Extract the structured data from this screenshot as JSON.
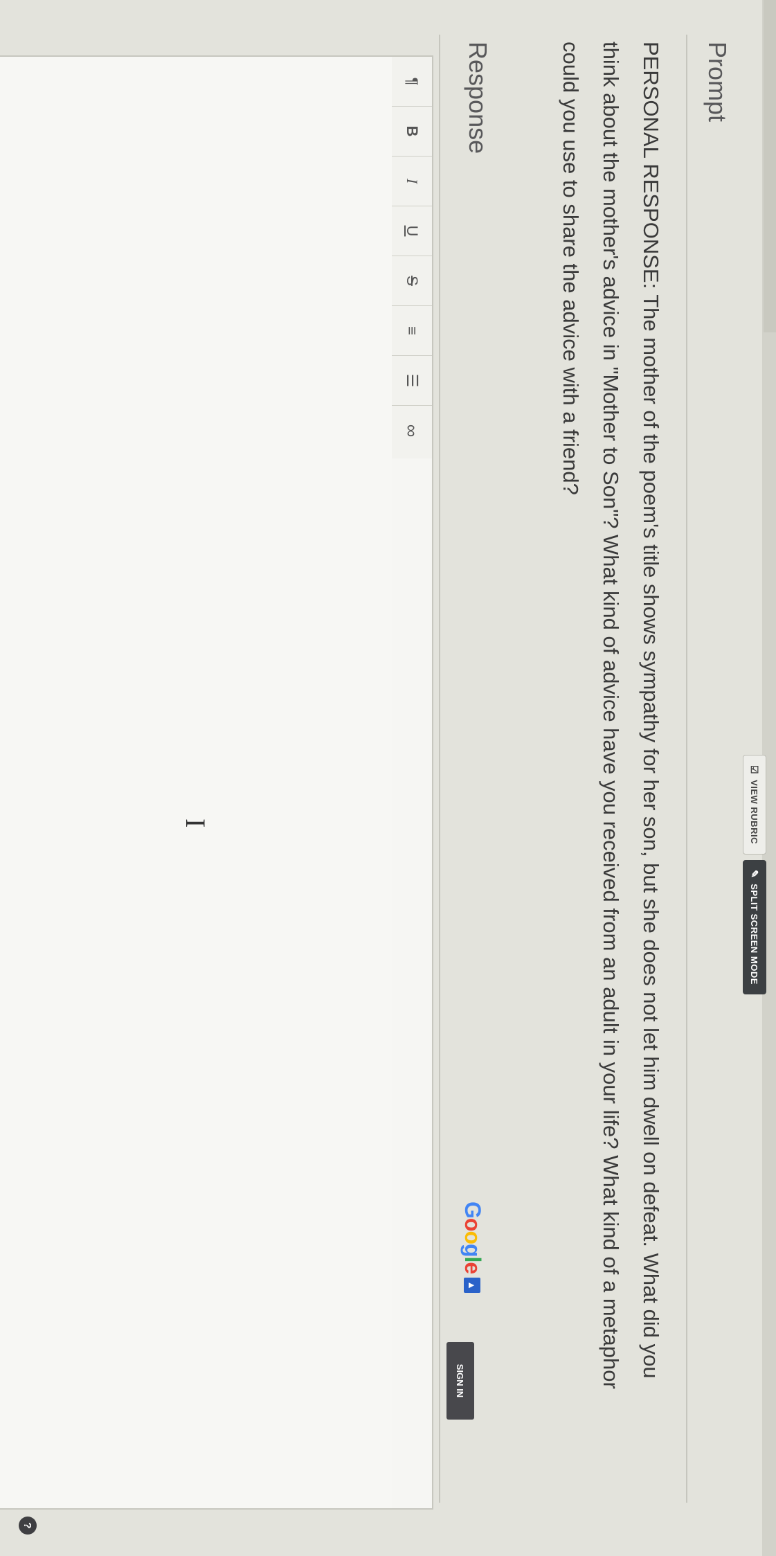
{
  "header": {
    "view_rubric_icon": "checkbox-icon",
    "view_rubric_label": "VIEW RUBRIC",
    "split_screen_icon": "pencil-icon",
    "split_screen_label": "SPLIT SCREEN MODE"
  },
  "prompt": {
    "title": "Prompt",
    "text": "PERSONAL RESPONSE: The mother of the poem's title shows sympathy for her son, but she does not let him dwell on defeat. What did you think about the mother's advice in \"Mother to Son\"? What kind of advice have you received from an adult in your life? What kind of a metaphor could you use to share the advice with a friend?"
  },
  "response": {
    "title": "Response",
    "google_letters": [
      "G",
      "o",
      "o",
      "g",
      "l",
      "e"
    ],
    "google_colors": [
      "#4285f4",
      "#ea4335",
      "#fbbc05",
      "#4285f4",
      "#34a853",
      "#ea4335"
    ],
    "drive_icon": "google-drive-icon",
    "sign_in_label": "SIGN IN"
  },
  "editor": {
    "toolbar": [
      {
        "name": "paragraph-button",
        "glyph": "¶"
      },
      {
        "name": "bold-button",
        "glyph": "B"
      },
      {
        "name": "italic-button",
        "glyph": "I"
      },
      {
        "name": "underline-button",
        "glyph": "U"
      },
      {
        "name": "strikethrough-button",
        "glyph": "S"
      },
      {
        "name": "align-button",
        "glyph": "≡"
      },
      {
        "name": "list-button",
        "glyph": "☰"
      },
      {
        "name": "link-button",
        "glyph": "∞"
      }
    ],
    "value": "",
    "cursor_glyph": "I"
  },
  "help": {
    "label": "?"
  },
  "colors": {
    "button_dark": "#3c4043",
    "page_bg": "#e3e3dc"
  }
}
